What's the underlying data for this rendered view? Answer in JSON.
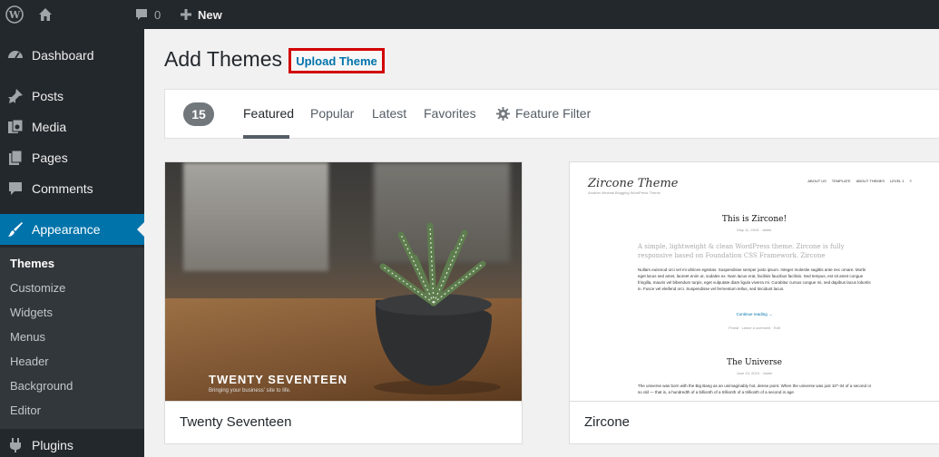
{
  "adminbar": {
    "comments_count": "0",
    "new_label": "New"
  },
  "sidebar": {
    "items": [
      {
        "label": "Dashboard",
        "icon": "dashboard-icon"
      },
      {
        "label": "Posts",
        "icon": "pin-icon"
      },
      {
        "label": "Media",
        "icon": "media-icon"
      },
      {
        "label": "Pages",
        "icon": "pages-icon"
      },
      {
        "label": "Comments",
        "icon": "comment-icon"
      },
      {
        "label": "Appearance",
        "icon": "brush-icon",
        "active": true
      },
      {
        "label": "Plugins",
        "icon": "plugin-icon"
      }
    ],
    "submenu": [
      "Themes",
      "Customize",
      "Widgets",
      "Menus",
      "Header",
      "Background",
      "Editor"
    ]
  },
  "page": {
    "title": "Add Themes",
    "upload_label": "Upload Theme"
  },
  "filter": {
    "count": "15",
    "tabs": [
      "Featured",
      "Popular",
      "Latest",
      "Favorites"
    ],
    "current_tab": "Featured",
    "feature_filter_label": "Feature Filter"
  },
  "themes": [
    {
      "name": "Twenty Seventeen",
      "preview_title": "TWENTY SEVENTEEN",
      "preview_tagline": "Bringing your business' site to life."
    },
    {
      "name": "Zircone",
      "preview": {
        "brand": "Zircone Theme",
        "brand_sub": "Another Minimal Blogging WordPress Theme",
        "nav": [
          "ABOUT US",
          "TEMPLATE",
          "ABOUT THEMES",
          "LEVEL 1",
          "≡"
        ],
        "post1_title": "This is Zircone!",
        "post1_meta": "May 11, 2015  ·  Jaider",
        "post1_lead": "A simple, lightweight & clean WordPress theme. Zircone is fully responsive based on Foundation CSS Framework. Zircone",
        "post1_body": "Nullam euismod orci vel mi ultrices egestas. Suspendisse semper justo ipsum. Integer molestie sagittis ante nec ornare. Morbi eget lacus sed amet, laoreet enim ut, sodales ex. Nam lacus erat, facilisis faucibus facilisis. Sed tempus, est sit amet congue fringilla, mauris vel bibendum turpis, eget vulputate diam ligula viverra mi. Curabitur cursus congue mi, sed dapibus lacus lobortis in. Fusce vel eleifend orci. Suspendisse vel fermentum tellus, sed tincidunt lacus.",
        "post1_link": "Continue reading →",
        "post1_foot": "Fineal   ·   Leave a comment   ·   Edit",
        "post2_title": "The Universe",
        "post2_meta": "June 19, 2015  ·  Jaider",
        "post2_body": "The universe was born with the Big Bang as an unimaginably hot, dense point. When the universe was just 10^-34 of a second or so old — that is, a hundredth of a billionth of a trillionth of a trillionth of a second in age"
      }
    }
  ]
}
